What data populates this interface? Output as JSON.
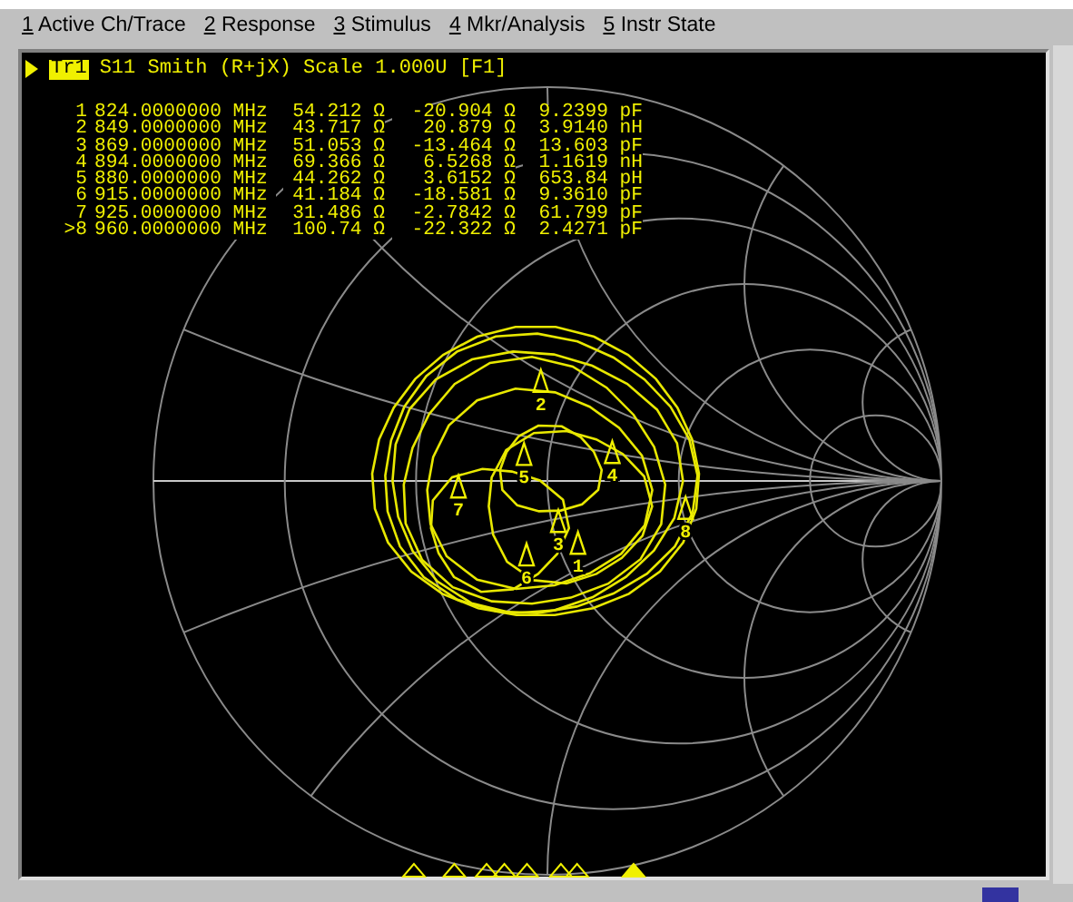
{
  "menu": [
    {
      "key": "1",
      "label": "Active Ch/Trace"
    },
    {
      "key": "2",
      "label": "Response"
    },
    {
      "key": "3",
      "label": "Stimulus"
    },
    {
      "key": "4",
      "label": "Mkr/Analysis"
    },
    {
      "key": "5",
      "label": "Instr State"
    }
  ],
  "trace": {
    "badge": "Tr1",
    "title": "S11 Smith (R+jX) Scale 1.000U [F1]"
  },
  "markers": [
    {
      "id": "1",
      "freq": "824.0000000 MHz",
      "r": "54.212 Ω",
      "x": "-20.904 Ω",
      "lc": "9.2399 pF",
      "chart_label": "1",
      "active": false
    },
    {
      "id": "2",
      "freq": "849.0000000 MHz",
      "r": "43.717 Ω",
      "x": "20.879 Ω",
      "lc": "3.9140 nH",
      "chart_label": "2",
      "active": false
    },
    {
      "id": "3",
      "freq": "869.0000000 MHz",
      "r": "51.053 Ω",
      "x": "-13.464 Ω",
      "lc": "13.603 pF",
      "chart_label": "3",
      "active": false
    },
    {
      "id": "4",
      "freq": "894.0000000 MHz",
      "r": "69.366 Ω",
      "x": "6.5268 Ω",
      "lc": "1.1619 nH",
      "chart_label": "4",
      "active": false
    },
    {
      "id": "5",
      "freq": "880.0000000 MHz",
      "r": "44.262 Ω",
      "x": "3.6152 Ω",
      "lc": "653.84 pH",
      "chart_label": "5",
      "active": false
    },
    {
      "id": "6",
      "freq": "915.0000000 MHz",
      "r": "41.184 Ω",
      "x": "-18.581 Ω",
      "lc": "9.3610 pF",
      "chart_label": "6",
      "active": false
    },
    {
      "id": "7",
      "freq": "925.0000000 MHz",
      "r": "31.486 Ω",
      "x": "-2.7842 Ω",
      "lc": "61.799 pF",
      "chart_label": "7",
      "active": false
    },
    {
      "id": ">8",
      "freq": "960.0000000 MHz",
      "r": "100.74 Ω",
      "x": "-22.322 Ω",
      "lc": "2.4271 pF",
      "chart_label": "8",
      "active": true
    }
  ]
}
